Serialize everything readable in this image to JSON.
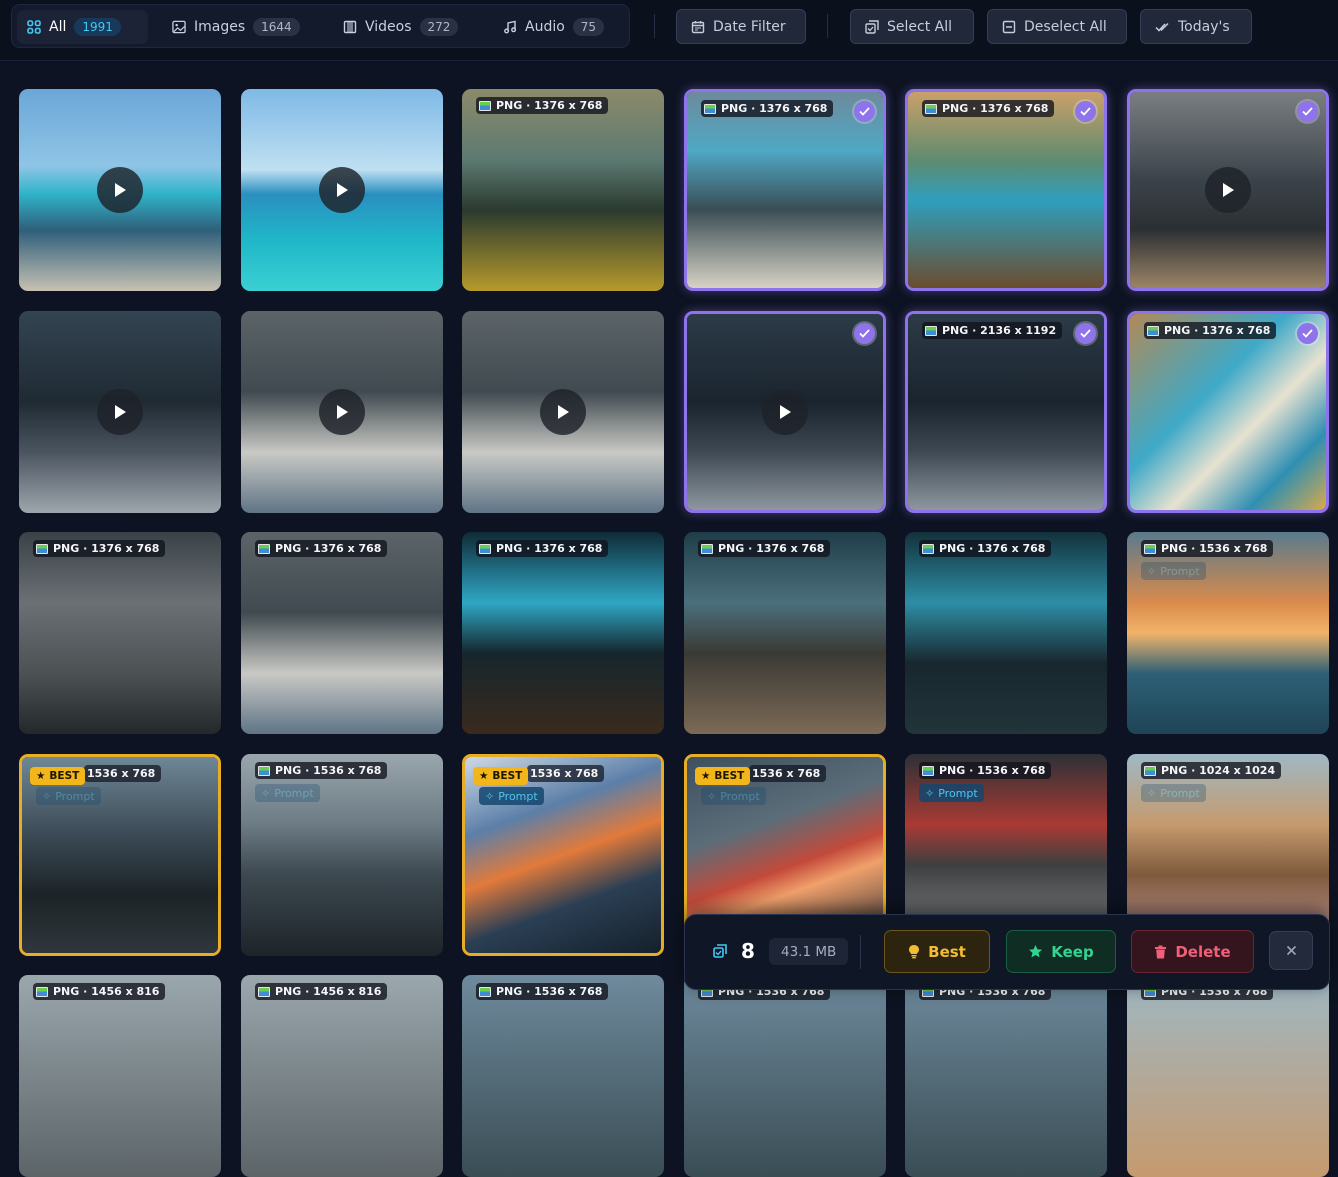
{
  "toolbar": {
    "tabs": [
      {
        "label": "All",
        "count": "1991",
        "icon": "grid-icon",
        "active": true
      },
      {
        "label": "Images",
        "count": "1644",
        "icon": "image-icon",
        "active": false
      },
      {
        "label": "Videos",
        "count": "272",
        "icon": "film-icon",
        "active": false
      },
      {
        "label": "Audio",
        "count": "75",
        "icon": "music-icon",
        "active": false
      }
    ],
    "date_filter": "Date Filter",
    "select_all": "Select All",
    "deselect_all": "Deselect All",
    "todays": "Today's"
  },
  "tiles": [
    {
      "label": "",
      "kind": "video",
      "selected": false,
      "best": false,
      "prompt": ""
    },
    {
      "label": "",
      "kind": "video",
      "selected": false,
      "best": false,
      "prompt": ""
    },
    {
      "label": "PNG · 1376 x 768",
      "kind": "image",
      "selected": false,
      "best": false,
      "prompt": ""
    },
    {
      "label": "PNG · 1376 x 768",
      "kind": "image",
      "selected": true,
      "best": false,
      "prompt": ""
    },
    {
      "label": "PNG · 1376 x 768",
      "kind": "image",
      "selected": true,
      "best": false,
      "prompt": ""
    },
    {
      "label": "",
      "kind": "video",
      "selected": true,
      "best": false,
      "prompt": ""
    },
    {
      "label": "",
      "kind": "video",
      "selected": false,
      "best": false,
      "prompt": ""
    },
    {
      "label": "",
      "kind": "video",
      "selected": false,
      "best": false,
      "prompt": ""
    },
    {
      "label": "",
      "kind": "video",
      "selected": false,
      "best": false,
      "prompt": ""
    },
    {
      "label": "",
      "kind": "video",
      "selected": true,
      "best": false,
      "prompt": ""
    },
    {
      "label": "PNG · 2136 x 1192",
      "kind": "image",
      "selected": true,
      "best": false,
      "prompt": ""
    },
    {
      "label": "PNG · 1376 x 768",
      "kind": "image",
      "selected": true,
      "best": false,
      "prompt": ""
    },
    {
      "label": "PNG · 1376 x 768",
      "kind": "image",
      "selected": false,
      "best": false,
      "prompt": ""
    },
    {
      "label": "PNG · 1376 x 768",
      "kind": "image",
      "selected": false,
      "best": false,
      "prompt": ""
    },
    {
      "label": "PNG · 1376 x 768",
      "kind": "image",
      "selected": false,
      "best": false,
      "prompt": ""
    },
    {
      "label": "PNG · 1376 x 768",
      "kind": "image",
      "selected": false,
      "best": false,
      "prompt": ""
    },
    {
      "label": "PNG · 1376 x 768",
      "kind": "image",
      "selected": false,
      "best": false,
      "prompt": ""
    },
    {
      "label": "PNG · 1536 x 768",
      "kind": "image",
      "selected": false,
      "best": false,
      "prompt": "Prompt",
      "prompt_faded": true
    },
    {
      "label": "1536 x 768",
      "kind": "image",
      "selected": false,
      "best": true,
      "prompt": "Prompt",
      "prompt_faded": true
    },
    {
      "label": "PNG · 1536 x 768",
      "kind": "image",
      "selected": false,
      "best": false,
      "prompt": "Prompt",
      "prompt_faded": true
    },
    {
      "label": "1536 x 768",
      "kind": "image",
      "selected": false,
      "best": true,
      "prompt": "Prompt"
    },
    {
      "label": "1536 x 768",
      "kind": "image",
      "selected": false,
      "best": true,
      "prompt": "Prompt",
      "prompt_faded": true
    },
    {
      "label": "PNG · 1536 x 768",
      "kind": "image",
      "selected": false,
      "best": false,
      "prompt": "Prompt"
    },
    {
      "label": "PNG · 1024 x 1024",
      "kind": "image",
      "selected": false,
      "best": false,
      "prompt": "Prompt",
      "prompt_faded": true
    },
    {
      "label": "PNG · 1456 x 816",
      "kind": "image",
      "selected": false,
      "best": false,
      "prompt": ""
    },
    {
      "label": "PNG · 1456 x 816",
      "kind": "image",
      "selected": false,
      "best": false,
      "prompt": ""
    },
    {
      "label": "PNG · 1536 x 768",
      "kind": "image",
      "selected": false,
      "best": false,
      "prompt": ""
    },
    {
      "label": "PNG · 1536 x 768",
      "kind": "image",
      "selected": false,
      "best": false,
      "prompt": ""
    },
    {
      "label": "PNG · 1536 x 768",
      "kind": "image",
      "selected": false,
      "best": false,
      "prompt": ""
    },
    {
      "label": "PNG · 1536 x 768",
      "kind": "image",
      "selected": false,
      "best": false,
      "prompt": ""
    }
  ],
  "best_label": "BEST",
  "action_bar": {
    "count": "8",
    "size": "43.1 MB",
    "best": "Best",
    "keep": "Keep",
    "delete": "Delete"
  },
  "colors": {
    "accent_select": "#8e73ea",
    "best": "#f2b61b",
    "keep": "#33d392",
    "delete": "#f16078",
    "info": "#43c8f4"
  }
}
